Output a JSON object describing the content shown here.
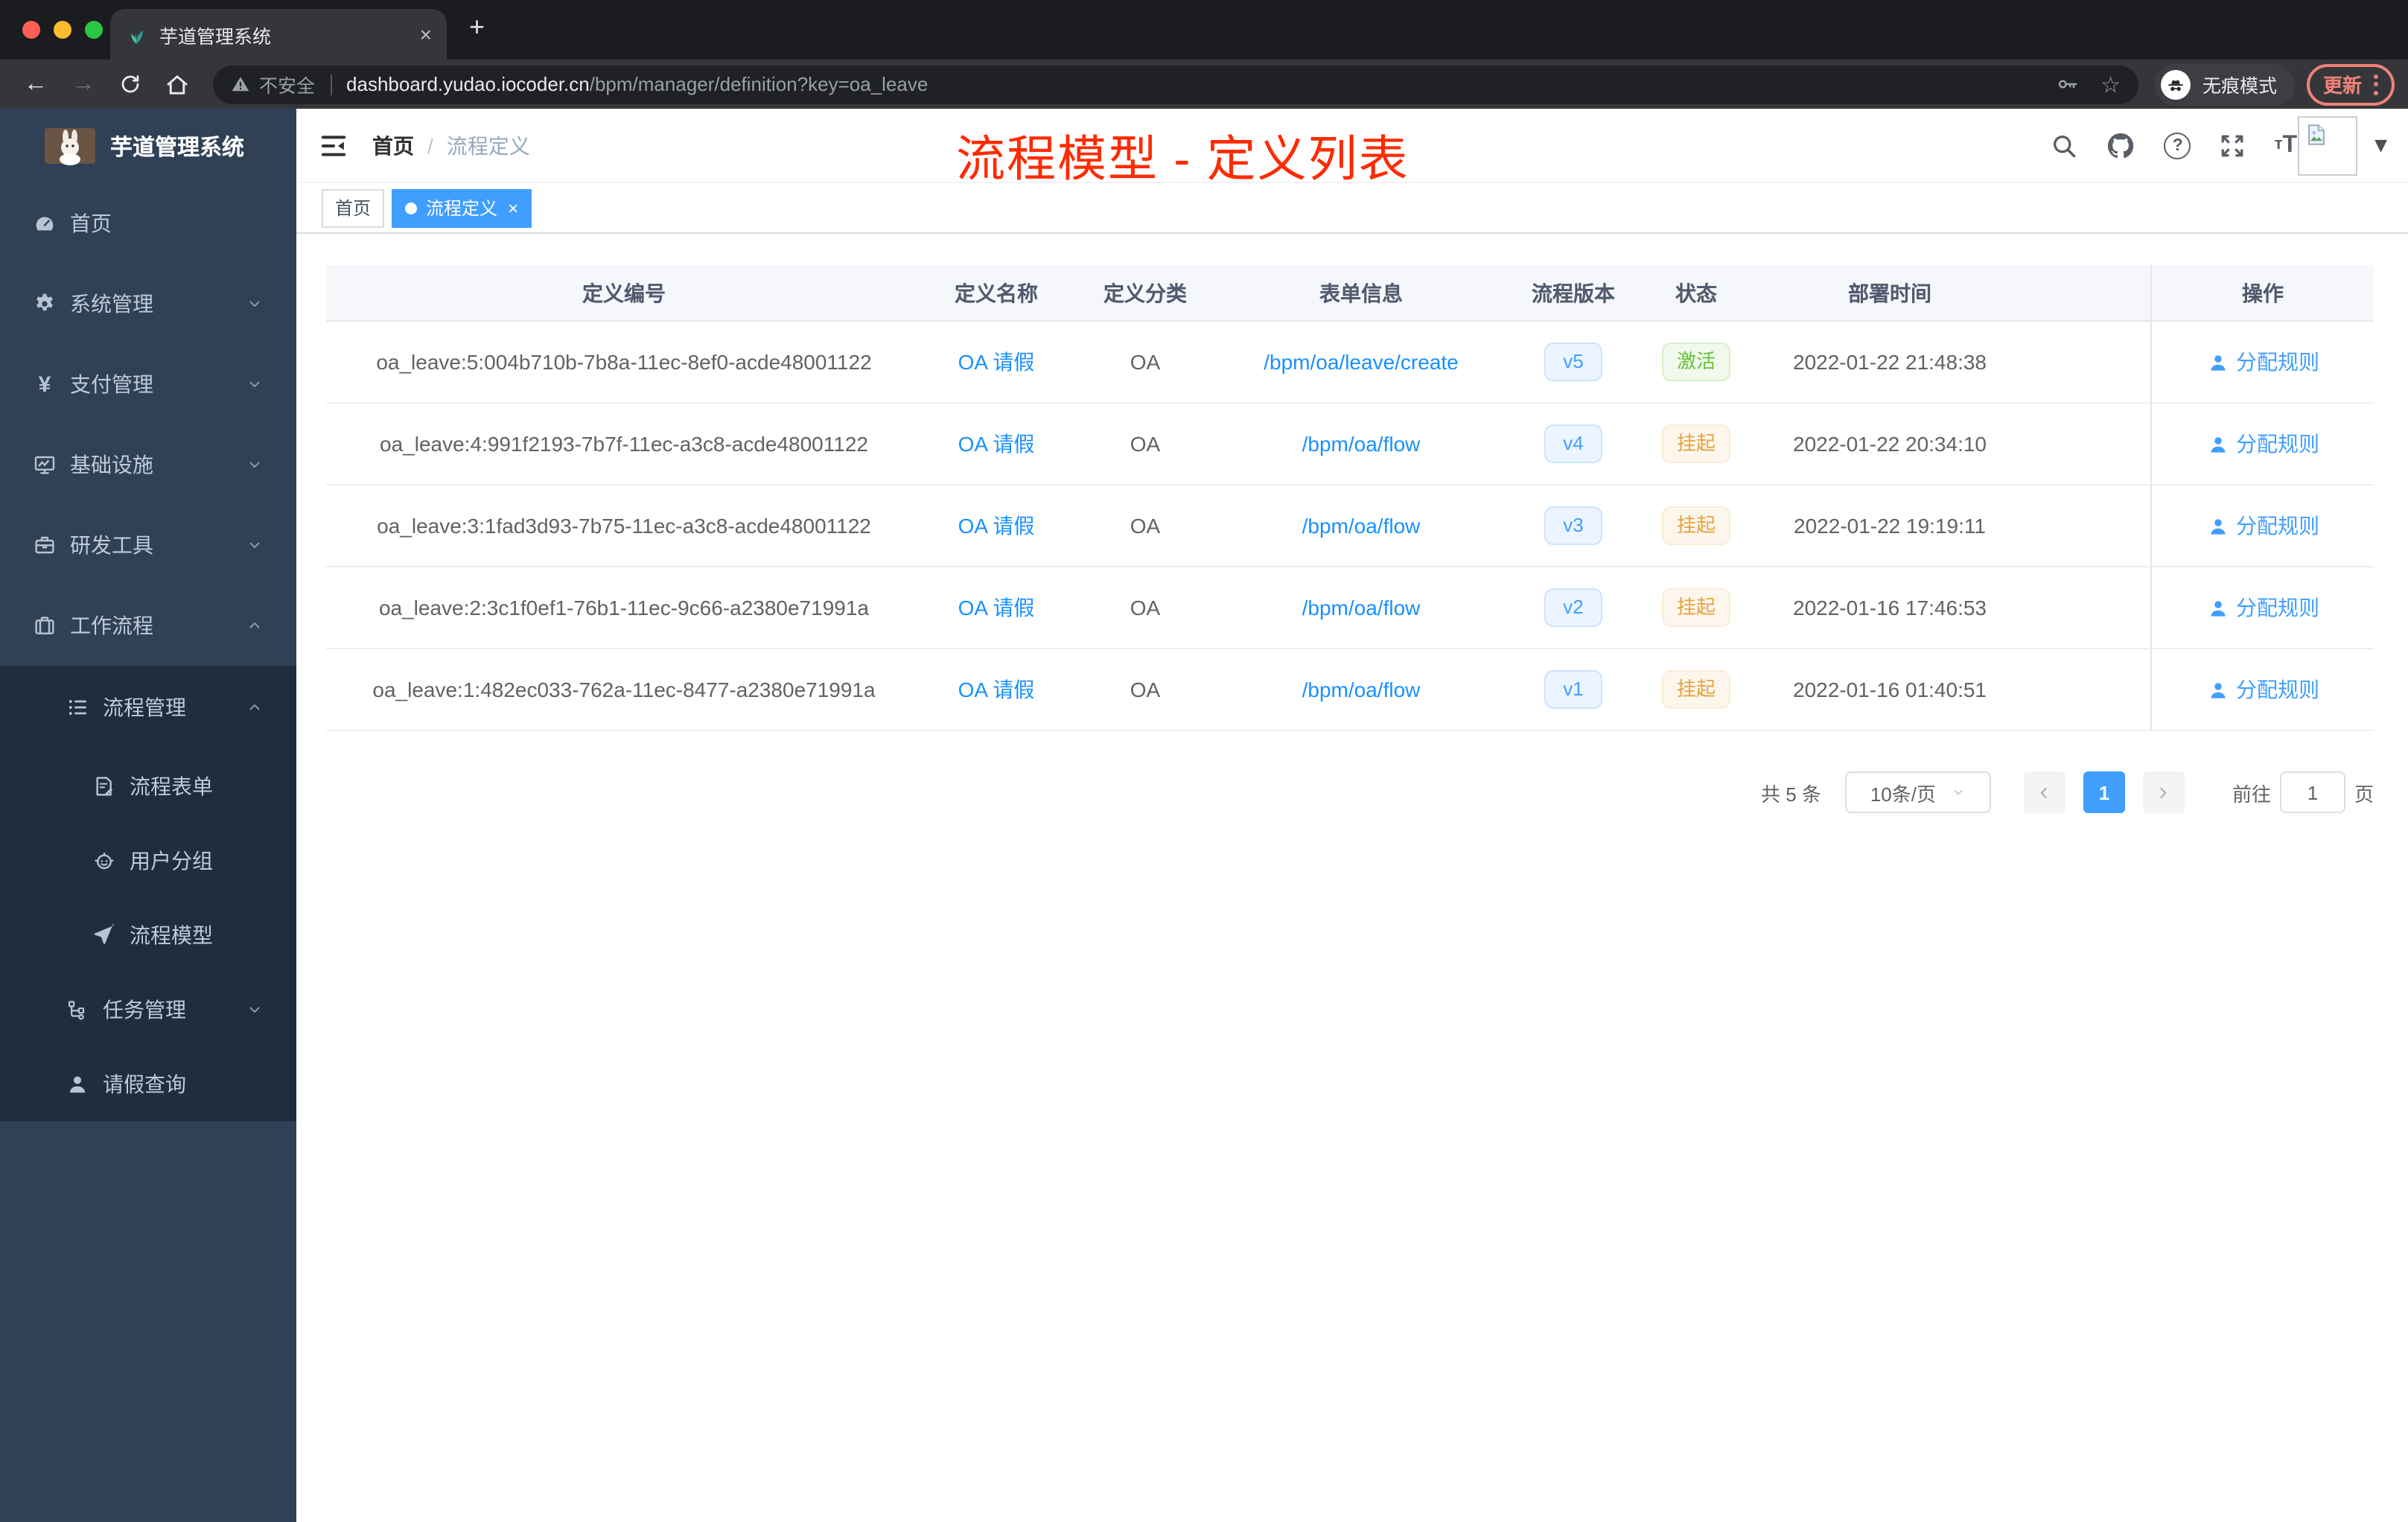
{
  "browser": {
    "tab": {
      "title": "芋道管理系统",
      "close_glyph": "×",
      "new_tab_glyph": "+"
    },
    "address_bar": {
      "security_label": "不安全",
      "host": "dashboard.yudao.iocoder.cn",
      "path": "/bpm/manager/definition?key=oa_leave"
    },
    "incognito_label": "无痕模式",
    "update_label": "更新"
  },
  "sidebar": {
    "logo_title": "芋道管理系统",
    "menu": [
      {
        "key": "home",
        "label": "首页",
        "icon": "dashboard",
        "level": 1,
        "arrow": "",
        "dark": false
      },
      {
        "key": "system",
        "label": "系统管理",
        "icon": "gear",
        "level": 1,
        "arrow": "down",
        "dark": false
      },
      {
        "key": "payment",
        "label": "支付管理",
        "icon": "yen",
        "level": 1,
        "arrow": "down",
        "dark": false
      },
      {
        "key": "infra",
        "label": "基础设施",
        "icon": "monitor",
        "level": 1,
        "arrow": "down",
        "dark": false
      },
      {
        "key": "devtools",
        "label": "研发工具",
        "icon": "toolbox",
        "level": 1,
        "arrow": "down",
        "dark": false
      },
      {
        "key": "workflow",
        "label": "工作流程",
        "icon": "case",
        "level": 1,
        "arrow": "up",
        "dark": false
      },
      {
        "key": "process-mgmt",
        "label": "流程管理",
        "icon": "list",
        "level": 2,
        "arrow": "up",
        "dark": true
      },
      {
        "key": "process-form",
        "label": "流程表单",
        "icon": "form",
        "level": 3,
        "arrow": "",
        "dark": true
      },
      {
        "key": "user-group",
        "label": "用户分组",
        "icon": "robot",
        "level": 3,
        "arrow": "",
        "dark": true
      },
      {
        "key": "process-model",
        "label": "流程模型",
        "icon": "plane",
        "level": 3,
        "arrow": "",
        "dark": true
      },
      {
        "key": "task-mgmt",
        "label": "任务管理",
        "icon": "tree",
        "level": 2,
        "arrow": "down",
        "dark": true
      },
      {
        "key": "leave-query",
        "label": "请假查询",
        "icon": "user",
        "level": 2,
        "arrow": "",
        "dark": true
      }
    ]
  },
  "header": {
    "breadcrumb": {
      "home": "首页",
      "separator": "/",
      "current": "流程定义"
    },
    "annotation": "流程模型 - 定义列表",
    "tags": [
      {
        "label": "首页",
        "active": false
      },
      {
        "label": "流程定义",
        "active": true,
        "close_glyph": "×"
      }
    ]
  },
  "table": {
    "columns": [
      "定义编号",
      "定义名称",
      "定义分类",
      "表单信息",
      "流程版本",
      "状态",
      "部署时间",
      "操作"
    ],
    "action_label": "分配规则",
    "rows": [
      {
        "id": "oa_leave:5:004b710b-7b8a-11ec-8ef0-acde48001122",
        "name": "OA 请假",
        "category": "OA",
        "form": "/bpm/oa/leave/create",
        "version": "v5",
        "status": "激活",
        "status_type": "success",
        "deploy_time": "2022-01-22 21:48:38"
      },
      {
        "id": "oa_leave:4:991f2193-7b7f-11ec-a3c8-acde48001122",
        "name": "OA 请假",
        "category": "OA",
        "form": "/bpm/oa/flow",
        "version": "v4",
        "status": "挂起",
        "status_type": "warning",
        "deploy_time": "2022-01-22 20:34:10"
      },
      {
        "id": "oa_leave:3:1fad3d93-7b75-11ec-a3c8-acde48001122",
        "name": "OA 请假",
        "category": "OA",
        "form": "/bpm/oa/flow",
        "version": "v3",
        "status": "挂起",
        "status_type": "warning",
        "deploy_time": "2022-01-22 19:19:11"
      },
      {
        "id": "oa_leave:2:3c1f0ef1-76b1-11ec-9c66-a2380e71991a",
        "name": "OA 请假",
        "category": "OA",
        "form": "/bpm/oa/flow",
        "version": "v2",
        "status": "挂起",
        "status_type": "warning",
        "deploy_time": "2022-01-16 17:46:53"
      },
      {
        "id": "oa_leave:1:482ec033-762a-11ec-8477-a2380e71991a",
        "name": "OA 请假",
        "category": "OA",
        "form": "/bpm/oa/flow",
        "version": "v1",
        "status": "挂起",
        "status_type": "warning",
        "deploy_time": "2022-01-16 01:40:51"
      }
    ]
  },
  "pagination": {
    "total": "共 5 条",
    "page_size": "10条/页",
    "current_page": "1",
    "goto_label": "前往",
    "goto_value": "1",
    "page_unit": "页"
  },
  "colors": {
    "accent": "#409eff",
    "link": "#1890ff",
    "sidebar_bg": "#304156",
    "submenu_bg": "#1f2d3d",
    "annotation_red": "#fe2b01",
    "success_green": "#67c23a",
    "warning_orange": "#e6a23c"
  }
}
